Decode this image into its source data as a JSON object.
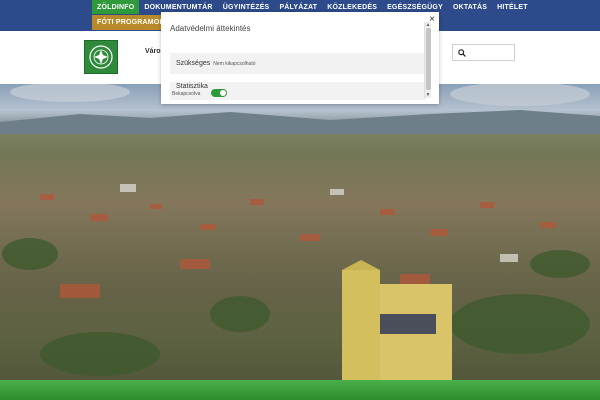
{
  "nav": {
    "row1": [
      {
        "label": "ZÖLDINFO",
        "style": "green"
      },
      {
        "label": "DOKUMENTUMTÁR",
        "style": "plain"
      },
      {
        "label": "ÜGYINTÉZÉS",
        "style": "plain"
      },
      {
        "label": "PÁLYÁZAT",
        "style": "plain"
      },
      {
        "label": "KÖZLEKEDÉS",
        "style": "plain"
      },
      {
        "label": "EGÉSZSÉGÜGY",
        "style": "plain"
      },
      {
        "label": "OKTATÁS",
        "style": "plain"
      },
      {
        "label": "HITÉLET",
        "style": "plain"
      }
    ],
    "row2": [
      {
        "label": "FÓTI PROGRAMOK",
        "style": "gold"
      }
    ]
  },
  "header": {
    "site_name": "Város"
  },
  "search": {
    "placeholder": ""
  },
  "cookie_modal": {
    "title": "Adatvédelmi áttekintés",
    "close_label": "×",
    "preferences": [
      {
        "name": "Szükséges",
        "note": "Nem kikapcsolható"
      },
      {
        "name": "Statisztika",
        "status": "Bekapcsolva",
        "enabled": true
      }
    ]
  },
  "colors": {
    "nav_bg": "#2d4a8a",
    "accent_green": "#2e9a3a",
    "accent_gold": "#b88a2a"
  }
}
